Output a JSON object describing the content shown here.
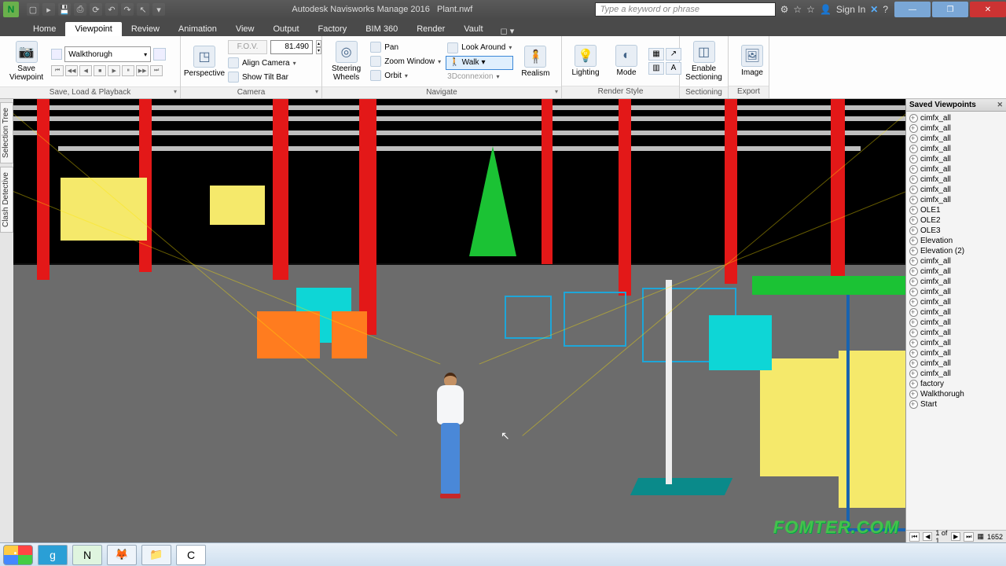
{
  "title": {
    "app": "Autodesk Navisworks Manage 2016",
    "file": "Plant.nwf"
  },
  "titlebar_search_placeholder": "Type a keyword or phrase",
  "titlebar_right": {
    "signin": "Sign In"
  },
  "tabs": [
    "Home",
    "Viewpoint",
    "Review",
    "Animation",
    "View",
    "Output",
    "Factory",
    "BIM 360",
    "Render",
    "Vault"
  ],
  "active_tab": "Viewpoint",
  "ribbon": {
    "save_load": {
      "label": "Save, Load & Playback",
      "save_viewpoint": "Save\nViewpoint",
      "walkthrough_select": "Walkthorugh"
    },
    "camera": {
      "label": "Camera",
      "perspective": "Perspective",
      "fov_label": "F.O.V.",
      "fov_value": "81.490",
      "align_camera": "Align Camera",
      "show_tilt": "Show Tilt Bar"
    },
    "navigate": {
      "label": "Navigate",
      "steering": "Steering\nWheels",
      "pan": "Pan",
      "zoom_window": "Zoom Window",
      "orbit": "Orbit",
      "look": "Look Around",
      "walk": "Walk",
      "connexion": "3Dconnexion",
      "realism": "Realism"
    },
    "render": {
      "label": "Render Style",
      "lighting": "Lighting",
      "mode": "Mode"
    },
    "sectioning": {
      "label": "Sectioning",
      "enable": "Enable\nSectioning"
    },
    "export": {
      "label": "Export",
      "image": "Image"
    }
  },
  "side_tabs": [
    "Selection Tree",
    "Clash Detective"
  ],
  "saved_viewpoints": {
    "title": "Saved Viewpoints",
    "items": [
      "cimfx_all",
      "cimfx_all",
      "cimfx_all",
      "cimfx_all",
      "cimfx_all",
      "cimfx_all",
      "cimfx_all",
      "cimfx_all",
      "cimfx_all",
      "OLE1",
      "OLE2",
      "OLE3",
      "Elevation",
      "Elevation (2)",
      "cimfx_all",
      "cimfx_all",
      "cimfx_all",
      "cimfx_all",
      "cimfx_all",
      "cimfx_all",
      "cimfx_all",
      "cimfx_all",
      "cimfx_all",
      "cimfx_all",
      "cimfx_all",
      "cimfx_all",
      "factory",
      "Walkthorugh",
      "Start"
    ],
    "status": {
      "page": "1 of 1",
      "count": "1652"
    }
  },
  "watermark": "FOMTER.COM"
}
